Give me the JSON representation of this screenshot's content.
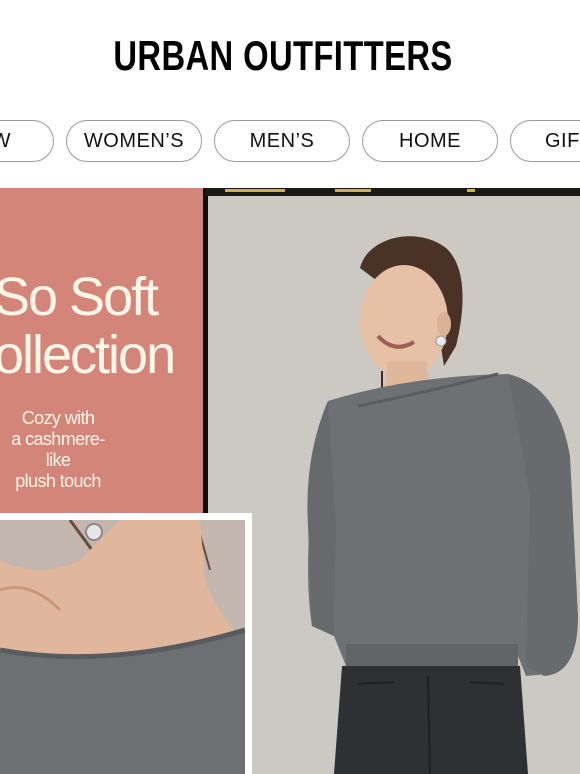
{
  "brand": {
    "logo_text": "URBAN OUTFITTERS"
  },
  "nav": {
    "items": [
      {
        "label": "W"
      },
      {
        "label": "WOMEN’S"
      },
      {
        "label": "MEN’S"
      },
      {
        "label": "HOME"
      },
      {
        "label": "GIF"
      }
    ]
  },
  "hero": {
    "headline_line1": "So Soft",
    "headline_line2": "ollection",
    "subtext_line1": "Cozy with",
    "subtext_line2": "a cashmere-like",
    "subtext_line3": "plush touch",
    "colors": {
      "panel": "#d4857a",
      "headline": "#fff6e8",
      "sweater": "#6e7174",
      "backdrop": "#cfccc6"
    }
  }
}
